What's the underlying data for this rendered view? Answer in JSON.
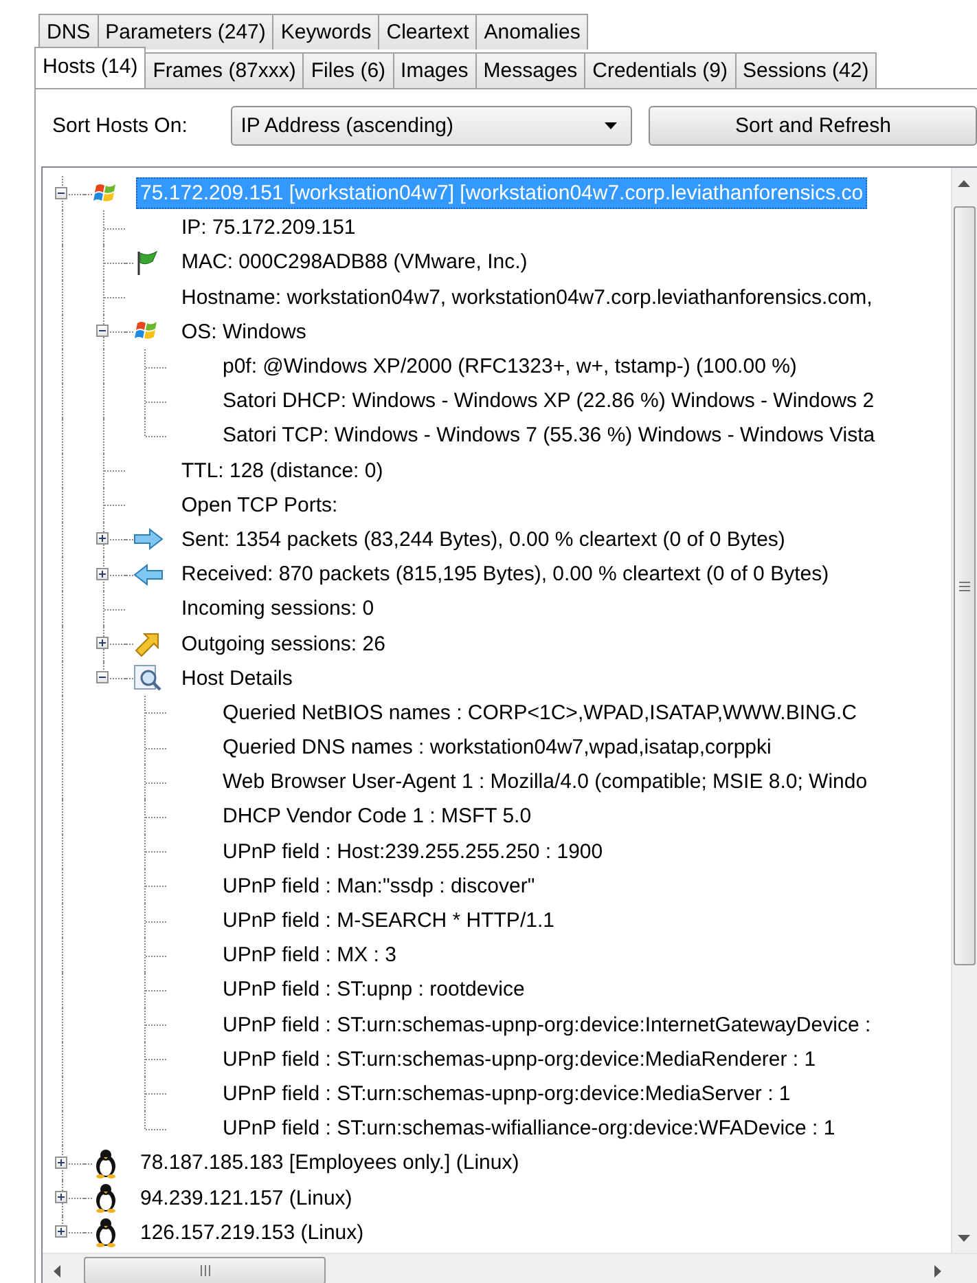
{
  "tabs_row_1": [
    {
      "label": "DNS",
      "selected": false
    },
    {
      "label": "Parameters (247)",
      "selected": false
    },
    {
      "label": "Keywords",
      "selected": false
    },
    {
      "label": "Cleartext",
      "selected": false
    },
    {
      "label": "Anomalies",
      "selected": false
    }
  ],
  "tabs_row_2": [
    {
      "label": "Hosts (14)",
      "selected": true
    },
    {
      "label": "Frames (87xxx)",
      "selected": false
    },
    {
      "label": "Files (6)",
      "selected": false
    },
    {
      "label": "Images",
      "selected": false
    },
    {
      "label": "Messages",
      "selected": false
    },
    {
      "label": "Credentials (9)",
      "selected": false
    },
    {
      "label": "Sessions (42)",
      "selected": false
    }
  ],
  "sort": {
    "label": "Sort Hosts On:",
    "value": "IP Address (ascending)",
    "button": "Sort and Refresh"
  },
  "tree": [
    {
      "text": "75.172.209.151 [workstation04w7] [workstation04w7.corp.leviathanforensics.co",
      "kind": "windows",
      "expanded": true,
      "selected": true,
      "children": [
        {
          "text": "IP: 75.172.209.151",
          "kind": "plain",
          "selected": false
        },
        {
          "text": "MAC: 000C298ADB88 (VMware, Inc.)",
          "kind": "flag",
          "selected": false
        },
        {
          "text": "Hostname: workstation04w7, workstation04w7.corp.leviathanforensics.com,",
          "kind": "plain",
          "selected": false
        },
        {
          "text": "OS: Windows",
          "kind": "windows",
          "expanded": true,
          "selected": false,
          "children": [
            {
              "text": "p0f: @Windows XP/2000 (RFC1323+, w+, tstamp-) (100.00 %)",
              "kind": "plain",
              "selected": false
            },
            {
              "text": "Satori DHCP: Windows - Windows XP (22.86 %) Windows - Windows 2",
              "kind": "plain",
              "selected": false
            },
            {
              "text": "Satori TCP: Windows - Windows 7 (55.36 %) Windows - Windows Vista",
              "kind": "plain",
              "selected": false
            }
          ]
        },
        {
          "text": "TTL: 128 (distance: 0)",
          "kind": "plain",
          "selected": false
        },
        {
          "text": "Open TCP Ports:",
          "kind": "plain",
          "selected": false
        },
        {
          "text": "Sent: 1354 packets (83,244 Bytes), 0.00 % cleartext (0 of 0 Bytes)",
          "kind": "arrow-right",
          "expanded": false,
          "selected": false
        },
        {
          "text": "Received: 870 packets (815,195 Bytes), 0.00 % cleartext (0 of 0 Bytes)",
          "kind": "arrow-left",
          "expanded": false,
          "selected": false
        },
        {
          "text": "Incoming sessions: 0",
          "kind": "plain",
          "selected": false
        },
        {
          "text": "Outgoing sessions: 26",
          "kind": "arrow-diagonal",
          "expanded": false,
          "selected": false
        },
        {
          "text": "Host Details",
          "kind": "magnifier",
          "expanded": true,
          "selected": false,
          "children": [
            {
              "text": "Queried NetBIOS names : CORP<1C>,WPAD,ISATAP,WWW.BING.C",
              "kind": "plain",
              "selected": false
            },
            {
              "text": "Queried DNS names : workstation04w7,wpad,isatap,corppki",
              "kind": "plain",
              "selected": false
            },
            {
              "text": "Web Browser User-Agent 1 : Mozilla/4.0 (compatible; MSIE 8.0; Windo",
              "kind": "plain",
              "selected": false
            },
            {
              "text": "DHCP Vendor Code 1 : MSFT 5.0",
              "kind": "plain",
              "selected": false
            },
            {
              "text": "UPnP field : Host:239.255.255.250 : 1900",
              "kind": "plain",
              "selected": false
            },
            {
              "text": "UPnP field : Man:\"ssdp : discover\"",
              "kind": "plain",
              "selected": false
            },
            {
              "text": "UPnP field : M-SEARCH * HTTP/1.1",
              "kind": "plain",
              "selected": false
            },
            {
              "text": "UPnP field : MX : 3",
              "kind": "plain",
              "selected": false
            },
            {
              "text": "UPnP field : ST:upnp : rootdevice",
              "kind": "plain",
              "selected": false
            },
            {
              "text": "UPnP field : ST:urn:schemas-upnp-org:device:InternetGatewayDevice :",
              "kind": "plain",
              "selected": false
            },
            {
              "text": "UPnP field : ST:urn:schemas-upnp-org:device:MediaRenderer : 1",
              "kind": "plain",
              "selected": false
            },
            {
              "text": "UPnP field : ST:urn:schemas-upnp-org:device:MediaServer : 1",
              "kind": "plain",
              "selected": false
            },
            {
              "text": "UPnP field : ST:urn:schemas-wifialliance-org:device:WFADevice : 1",
              "kind": "plain",
              "selected": false
            }
          ]
        }
      ]
    },
    {
      "text": "78.187.185.183 [Employees only.] (Linux)",
      "kind": "penguin",
      "expanded": false,
      "selected": false
    },
    {
      "text": "94.239.121.157 (Linux)",
      "kind": "penguin",
      "expanded": false,
      "selected": false
    },
    {
      "text": "126.157.219.153 (Linux)",
      "kind": "penguin",
      "expanded": false,
      "selected": false
    }
  ]
}
